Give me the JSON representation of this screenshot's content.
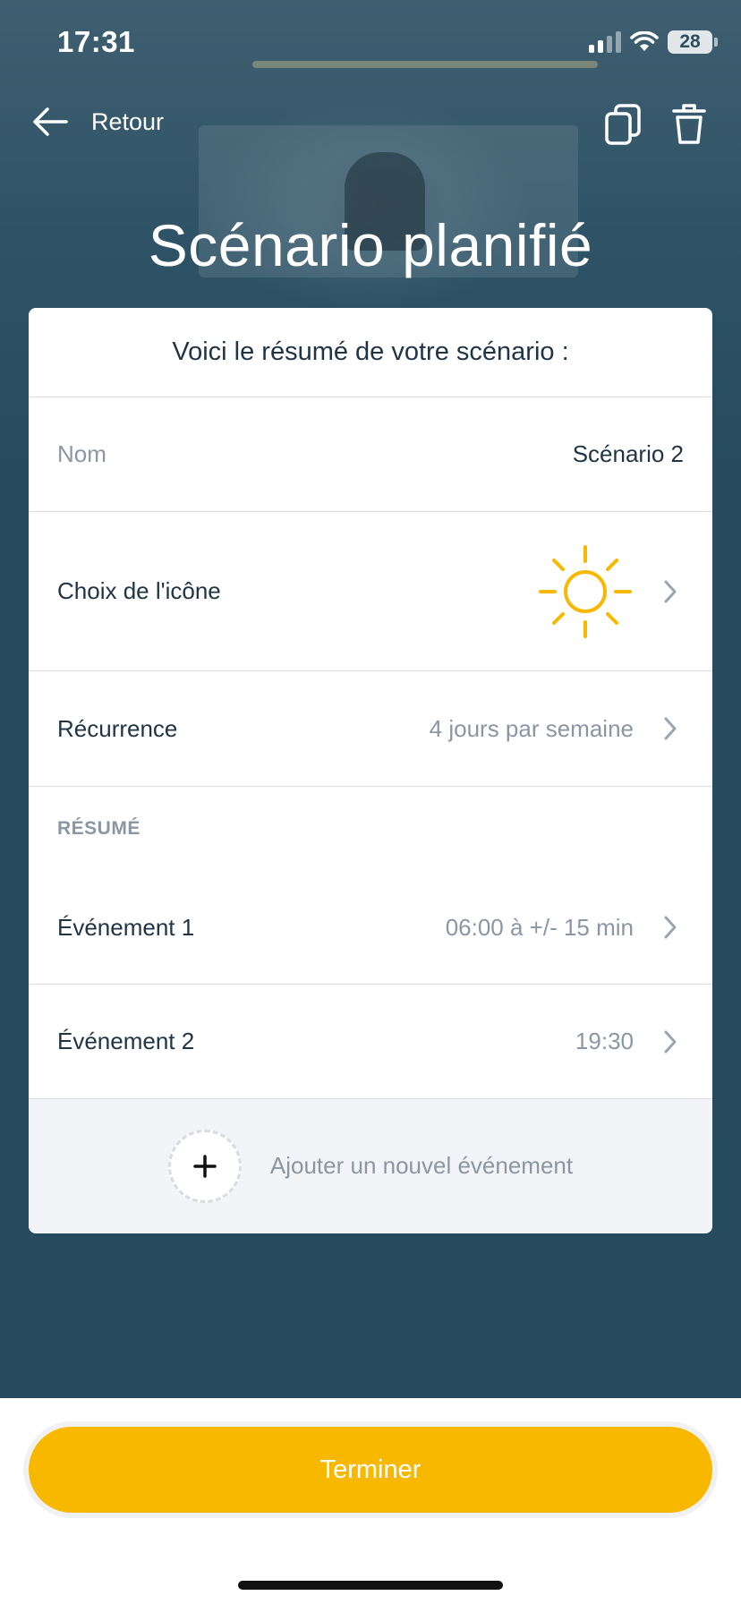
{
  "status_bar": {
    "time": "17:31",
    "battery": "28"
  },
  "nav": {
    "back_label": "Retour"
  },
  "page": {
    "title": "Scénario planifié"
  },
  "card": {
    "header": "Voici le résumé de votre scénario :",
    "name": {
      "label": "Nom",
      "value": "Scénario 2"
    },
    "icon_choice": {
      "label": "Choix de l'icône",
      "icon": "sun-icon",
      "icon_color": "#f9b800"
    },
    "recurrence": {
      "label": "Récurrence",
      "value": "4 jours par semaine"
    },
    "summary_section": "RÉSUMÉ",
    "events": [
      {
        "label": "Événement 1",
        "value": "06:00 à +/- 15 min"
      },
      {
        "label": "Événement 2",
        "value": "19:30"
      }
    ],
    "add_event_label": "Ajouter un nouvel événement"
  },
  "finish_button": "Terminer",
  "colors": {
    "accent": "#f9b800",
    "background": "#264a5e",
    "text_dark": "#1f3444",
    "text_muted": "#8a97a3"
  }
}
